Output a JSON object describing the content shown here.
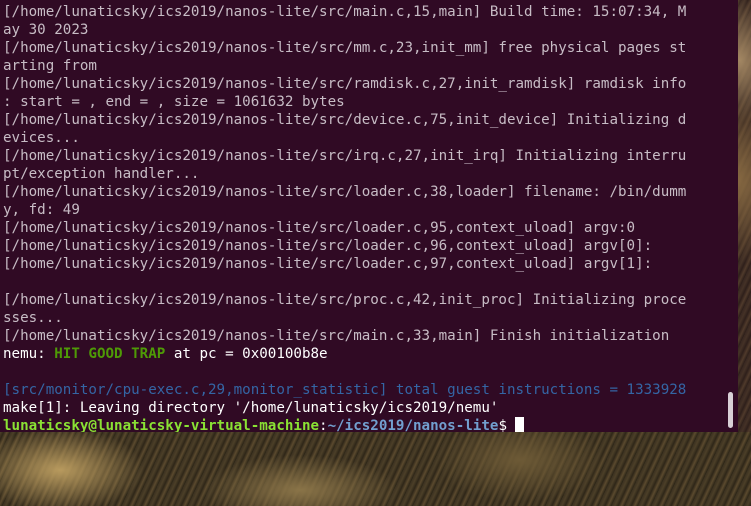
{
  "terminal": {
    "lines": [
      "[/home/lunaticsky/ics2019/nanos-lite/src/main.c,15,main] Build time: 15:07:34, M",
      "ay 30 2023",
      "[/home/lunaticsky/ics2019/nanos-lite/src/mm.c,23,init_mm] free physical pages st",
      "arting from",
      "[/home/lunaticsky/ics2019/nanos-lite/src/ramdisk.c,27,init_ramdisk] ramdisk info",
      ": start = , end = , size = 1061632 bytes",
      "[/home/lunaticsky/ics2019/nanos-lite/src/device.c,75,init_device] Initializing d",
      "evices...",
      "[/home/lunaticsky/ics2019/nanos-lite/src/irq.c,27,init_irq] Initializing interru",
      "pt/exception handler...",
      "[/home/lunaticsky/ics2019/nanos-lite/src/loader.c,38,loader] filename: /bin/dumm",
      "y, fd: 49",
      "[/home/lunaticsky/ics2019/nanos-lite/src/loader.c,95,context_uload] argv:0",
      "[/home/lunaticsky/ics2019/nanos-lite/src/loader.c,96,context_uload] argv[0]:",
      "[/home/lunaticsky/ics2019/nanos-lite/src/loader.c,97,context_uload] argv[1]:",
      "",
      "[/home/lunaticsky/ics2019/nanos-lite/src/proc.c,42,init_proc] Initializing proce",
      "sses...",
      "[/home/lunaticsky/ics2019/nanos-lite/src/main.c,33,main] Finish initialization"
    ],
    "trap_line": {
      "prefix": "nemu: ",
      "highlight": "HIT GOOD TRAP",
      "suffix": " at pc = 0x00100b8e"
    },
    "stat_line": "[src/monitor/cpu-exec.c,29,monitor_statistic] total guest instructions = 1333928",
    "make_line": "make[1]: Leaving directory '/home/lunaticsky/ics2019/nemu'",
    "prompt": {
      "user_host": "lunaticsky@lunaticsky-virtual-machine",
      "separator": ":",
      "path": "~/ics2019/nanos-lite",
      "symbol": "$"
    }
  },
  "colors": {
    "background": "#300a24",
    "text": "#c7bcc5",
    "trap_green": "#4e9a06",
    "stat_blue": "#3465a4",
    "prompt_green": "#8ae234",
    "prompt_blue": "#729fcf"
  }
}
